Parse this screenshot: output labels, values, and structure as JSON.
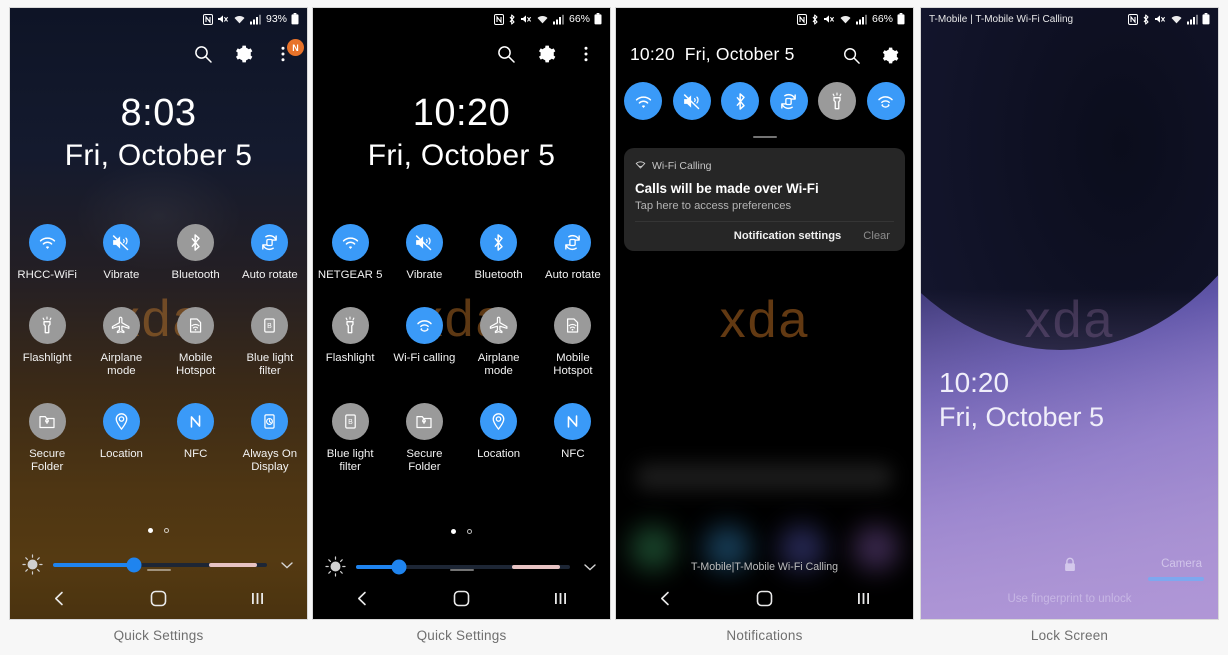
{
  "captions": [
    "Quick Settings",
    "Quick Settings",
    "Notifications",
    "Lock Screen"
  ],
  "colors": {
    "tile_on": "#3a9af8",
    "tile_off": "#9a9a9a",
    "slider_fill": "#1f84ef",
    "badge": "#e8732a",
    "watermark": "#c67c2e"
  },
  "watermark": "xda",
  "panel1": {
    "status": {
      "icons": [
        "nfc-icon",
        "mute-icon",
        "wifi-icon",
        "signal-icon"
      ],
      "battery_percent": "93%",
      "battery_icon": "battery-icon"
    },
    "top_actions": {
      "search": "search-icon",
      "settings": "gear-icon",
      "menu": "overflow-menu-icon",
      "badge": "N"
    },
    "clock": {
      "time": "8:03",
      "date": "Fri, October 5"
    },
    "tiles": [
      {
        "label": "RHCC-WiFi",
        "icon": "wifi-icon",
        "state": "on"
      },
      {
        "label": "Vibrate",
        "icon": "vibrate-icon",
        "state": "on"
      },
      {
        "label": "Bluetooth",
        "icon": "bluetooth-icon",
        "state": "off"
      },
      {
        "label": "Auto rotate",
        "icon": "auto-rotate-icon",
        "state": "on"
      },
      {
        "label": "Flashlight",
        "icon": "flashlight-icon",
        "state": "off"
      },
      {
        "label": "Airplane mode",
        "icon": "airplane-icon",
        "state": "off"
      },
      {
        "label": "Mobile Hotspot",
        "icon": "hotspot-icon",
        "state": "off"
      },
      {
        "label": "Blue light filter",
        "icon": "blue-light-icon",
        "state": "off"
      },
      {
        "label": "Secure Folder",
        "icon": "secure-folder-icon",
        "state": "off"
      },
      {
        "label": "Location",
        "icon": "location-icon",
        "state": "on"
      },
      {
        "label": "NFC",
        "icon": "nfc-icon",
        "state": "on"
      },
      {
        "label": "Always On Display",
        "icon": "always-on-display-icon",
        "state": "on"
      }
    ],
    "pager": {
      "pages": 2,
      "active": 1
    },
    "brightness": {
      "value_percent": 38,
      "icon": "brightness-icon",
      "expand": "chevron-down-icon"
    },
    "nav": [
      "back-icon",
      "home-icon",
      "recents-icon"
    ]
  },
  "panel2": {
    "status": {
      "icons": [
        "nfc-icon",
        "bluetooth-icon",
        "mute-icon",
        "wifi-icon",
        "signal-icon"
      ],
      "battery_percent": "66%",
      "battery_icon": "battery-icon"
    },
    "top_actions": {
      "search": "search-icon",
      "settings": "gear-icon",
      "menu": "overflow-menu-icon"
    },
    "clock": {
      "time": "10:20",
      "date": "Fri, October 5"
    },
    "tiles": [
      {
        "label": "NETGEAR 5",
        "icon": "wifi-icon",
        "state": "on"
      },
      {
        "label": "Vibrate",
        "icon": "vibrate-icon",
        "state": "on"
      },
      {
        "label": "Bluetooth",
        "icon": "bluetooth-icon",
        "state": "on"
      },
      {
        "label": "Auto rotate",
        "icon": "auto-rotate-icon",
        "state": "on"
      },
      {
        "label": "Flashlight",
        "icon": "flashlight-icon",
        "state": "off"
      },
      {
        "label": "Wi-Fi calling",
        "icon": "wifi-calling-icon",
        "state": "on"
      },
      {
        "label": "Airplane mode",
        "icon": "airplane-icon",
        "state": "off"
      },
      {
        "label": "Mobile Hotspot",
        "icon": "hotspot-icon",
        "state": "off"
      },
      {
        "label": "Blue light filter",
        "icon": "blue-light-icon",
        "state": "off"
      },
      {
        "label": "Secure Folder",
        "icon": "secure-folder-icon",
        "state": "off"
      },
      {
        "label": "Location",
        "icon": "location-icon",
        "state": "on"
      },
      {
        "label": "NFC",
        "icon": "nfc-icon",
        "state": "on"
      }
    ],
    "pager": {
      "pages": 2,
      "active": 1
    },
    "brightness": {
      "value_percent": 20,
      "icon": "brightness-icon",
      "expand": "chevron-down-icon"
    },
    "nav": [
      "back-icon",
      "home-icon",
      "recents-icon"
    ]
  },
  "panel3": {
    "status": {
      "icons": [
        "nfc-icon",
        "bluetooth-icon",
        "mute-icon",
        "wifi-icon",
        "signal-icon"
      ],
      "battery_percent": "66%",
      "battery_icon": "battery-icon"
    },
    "header": {
      "time": "10:20",
      "date": "Fri, October 5"
    },
    "header_actions": {
      "search": "search-icon",
      "settings": "gear-icon"
    },
    "quick_toggles": [
      {
        "icon": "wifi-icon",
        "state": "on"
      },
      {
        "icon": "vibrate-icon",
        "state": "on"
      },
      {
        "icon": "bluetooth-icon",
        "state": "on"
      },
      {
        "icon": "auto-rotate-icon",
        "state": "on"
      },
      {
        "icon": "flashlight-icon",
        "state": "off"
      },
      {
        "icon": "wifi-calling-icon",
        "state": "on"
      }
    ],
    "notification": {
      "app_icon": "wifi-calling-icon",
      "app_name": "Wi-Fi Calling",
      "title": "Calls will be made over Wi-Fi",
      "subtitle": "Tap here to access preferences",
      "primary_action": "Notification settings",
      "secondary_action": "Clear"
    },
    "carrier_footer": "T-Mobile|T-Mobile Wi-Fi Calling",
    "nav": [
      "back-icon",
      "home-icon",
      "recents-icon"
    ]
  },
  "panel4": {
    "status": {
      "carrier": "T-Mobile | T-Mobile Wi-Fi Calling",
      "icons": [
        "nfc-icon",
        "bluetooth-icon",
        "mute-icon",
        "wifi-icon",
        "signal-icon"
      ],
      "battery_icon": "battery-icon"
    },
    "clock": {
      "time": "10:20",
      "date": "Fri, October 5"
    },
    "lock_icon": "lock-icon",
    "hint": "Use fingerprint to unlock",
    "camera_label": "Camera"
  }
}
